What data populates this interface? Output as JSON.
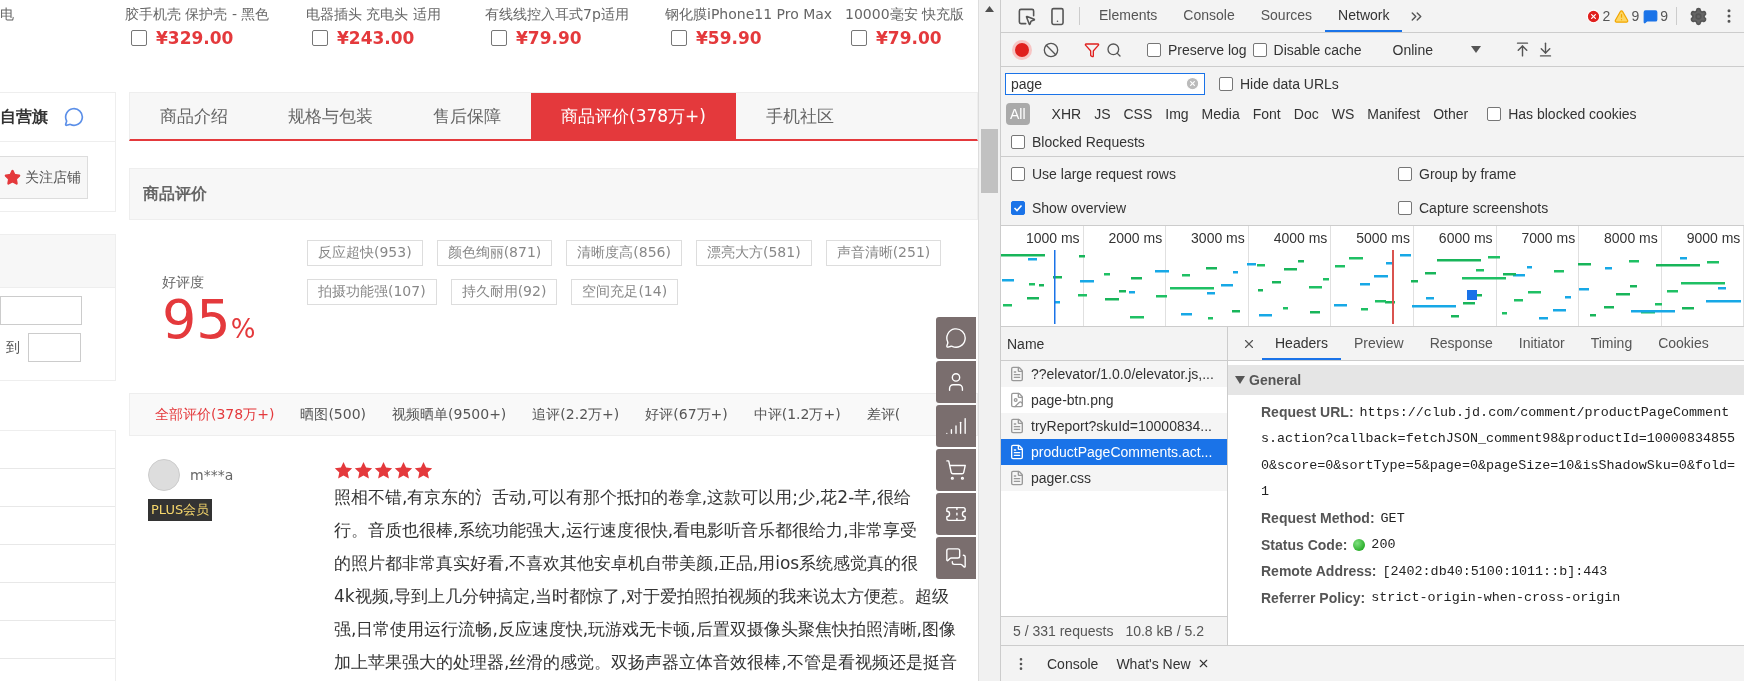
{
  "products": [
    {
      "name": "电"
    },
    {
      "name": "胶手机壳 保护壳 - 黑色",
      "price": "¥329.00",
      "checked": false
    },
    {
      "name": "电器插头 充电头 适用",
      "price": "¥243.00",
      "checked": false
    },
    {
      "name": "有线线控入耳式7p适用",
      "price": "¥79.90",
      "checked": false
    },
    {
      "name": "钢化膜iPhone11 Pro Max",
      "price": "¥59.90",
      "checked": false
    },
    {
      "name": "10000毫安 快充版",
      "price": "¥79.00",
      "checked": false
    }
  ],
  "shop": {
    "name": "自营旗",
    "follow": "关注店铺"
  },
  "price_filter": {
    "separator": "到"
  },
  "tabs": [
    {
      "label": "商品介绍",
      "selected": false
    },
    {
      "label": "规格与包装",
      "selected": false
    },
    {
      "label": "售后保障",
      "selected": false
    },
    {
      "label": "商品评价(378万+)",
      "selected": true
    },
    {
      "label": "手机社区",
      "selected": false
    }
  ],
  "section_title": "商品评价",
  "rating": {
    "label": "好评度",
    "value": "95",
    "unit": "%"
  },
  "tags": [
    "反应超快(953)",
    "颜色绚丽(871)",
    "清晰度高(856)",
    "漂亮大方(581)",
    "声音清晰(251)",
    "拍摄功能强(107)",
    "持久耐用(92)",
    "空间充足(14)"
  ],
  "filters": [
    {
      "label": "全部评价(378万+)",
      "selected": true
    },
    {
      "label": "晒图(500)",
      "selected": false
    },
    {
      "label": "视频晒单(9500+)",
      "selected": false
    },
    {
      "label": "追评(2.2万+)",
      "selected": false
    },
    {
      "label": "好评(67万+)",
      "selected": false
    },
    {
      "label": "中评(1.2万+)",
      "selected": false
    },
    {
      "label": "差评(",
      "selected": false
    }
  ],
  "review": {
    "user": "m***a",
    "badge": "PLUS会员",
    "stars": 5,
    "lines": [
      "照相不错,有京东的氵舌动,可以有那个抵扣的卷拿,这款可以用;少,花2-芊,很给",
      "行。音质也很棒,系统功能强大,运行速度很快,看电影听音乐都很给力,非常享受",
      "的照片都非常真实好看,不喜欢其他安卓机自带美颜,正品,用ios系统感觉真的很",
      "4k视频,导到上几分钟搞定,当时都惊了,对于爱拍照拍视频的我来说太方便惹。超级",
      "强,日常使用运行流畅,反应速度快,玩游戏无卡顿,后置双摄像头聚焦快拍照清晰,图像",
      "加上苹果强大的处理器,丝滑的感觉。双扬声器立体音效很棒,不管是看视频还是挺音"
    ]
  },
  "devtools": {
    "panel_tabs": [
      {
        "label": "Elements",
        "selected": false
      },
      {
        "label": "Console",
        "selected": false
      },
      {
        "label": "Sources",
        "selected": false
      },
      {
        "label": "Network",
        "selected": true
      }
    ],
    "counts": {
      "errors": "2",
      "warnings": "9",
      "messages": "9"
    },
    "recording": true,
    "options": [
      {
        "label": "Preserve log",
        "checked": false
      },
      {
        "label": "Disable cache",
        "checked": false
      }
    ],
    "throttle": "Online",
    "filter_value": "page",
    "hide_data_urls": {
      "label": "Hide data URLs",
      "checked": false
    },
    "types": [
      {
        "label": "All",
        "selected": true
      },
      {
        "label": "XHR",
        "selected": false
      },
      {
        "label": "JS",
        "selected": false
      },
      {
        "label": "CSS",
        "selected": false
      },
      {
        "label": "Img",
        "selected": false
      },
      {
        "label": "Media",
        "selected": false
      },
      {
        "label": "Font",
        "selected": false
      },
      {
        "label": "Doc",
        "selected": false
      },
      {
        "label": "WS",
        "selected": false
      },
      {
        "label": "Manifest",
        "selected": false
      },
      {
        "label": "Other",
        "selected": false
      }
    ],
    "has_blocked_cookies": {
      "label": "Has blocked cookies",
      "checked": false
    },
    "blocked_requests": {
      "label": "Blocked Requests",
      "checked": false
    },
    "settings": [
      {
        "label": "Use large request rows",
        "checked": false
      },
      {
        "label": "Group by frame",
        "checked": false
      },
      {
        "label": "Show overview",
        "checked": true
      },
      {
        "label": "Capture screenshots",
        "checked": false
      }
    ],
    "overview_ticks": [
      "1000 ms",
      "2000 ms",
      "3000 ms",
      "4000 ms",
      "5000 ms",
      "6000 ms",
      "7000 ms",
      "8000 ms",
      "9000 ms"
    ],
    "name_header": "Name",
    "requests": [
      {
        "name": "??elevator/1.0.0/elevator.js,...",
        "kind": "document",
        "selected": false
      },
      {
        "name": "page-btn.png",
        "kind": "image",
        "selected": false
      },
      {
        "name": "tryReport?skuId=10000834...",
        "kind": "document",
        "selected": false
      },
      {
        "name": "productPageComments.act...",
        "kind": "document",
        "selected": true
      },
      {
        "name": "pager.css",
        "kind": "document",
        "selected": false
      }
    ],
    "summary": [
      "5 / 331 requests",
      "10.8 kB / 5.2"
    ],
    "detail_tabs": [
      {
        "label": "Headers",
        "selected": true
      },
      {
        "label": "Preview",
        "selected": false
      },
      {
        "label": "Response",
        "selected": false
      },
      {
        "label": "Initiator",
        "selected": false
      },
      {
        "label": "Timing",
        "selected": false
      },
      {
        "label": "Cookies",
        "selected": false
      }
    ],
    "general": {
      "title": "General",
      "expanded": true,
      "rows": [
        {
          "label": "Request URL:",
          "kind": "text",
          "lines": [
            "https://club.jd.com/comment/productPageComment",
            "s.action?callback=fetchJSON_comment98&productId=10000834855",
            "0&score=0&sortType=5&page=0&pageSize=10&isShadowSku=0&fold=",
            "1"
          ]
        },
        {
          "label": "Request Method:",
          "kind": "text",
          "lines": [
            "GET"
          ]
        },
        {
          "label": "Status Code:",
          "kind": "status",
          "lines": [
            "200"
          ]
        },
        {
          "label": "Remote Address:",
          "kind": "text",
          "lines": [
            "[2402:db40:5100:1011::b]:443"
          ]
        },
        {
          "label": "Referrer Policy:",
          "kind": "text",
          "lines": [
            "strict-origin-when-cross-origin"
          ]
        }
      ]
    },
    "drawer_tabs": [
      {
        "label": "Console",
        "closable": false
      },
      {
        "label": "What's New",
        "closable": true
      }
    ]
  }
}
